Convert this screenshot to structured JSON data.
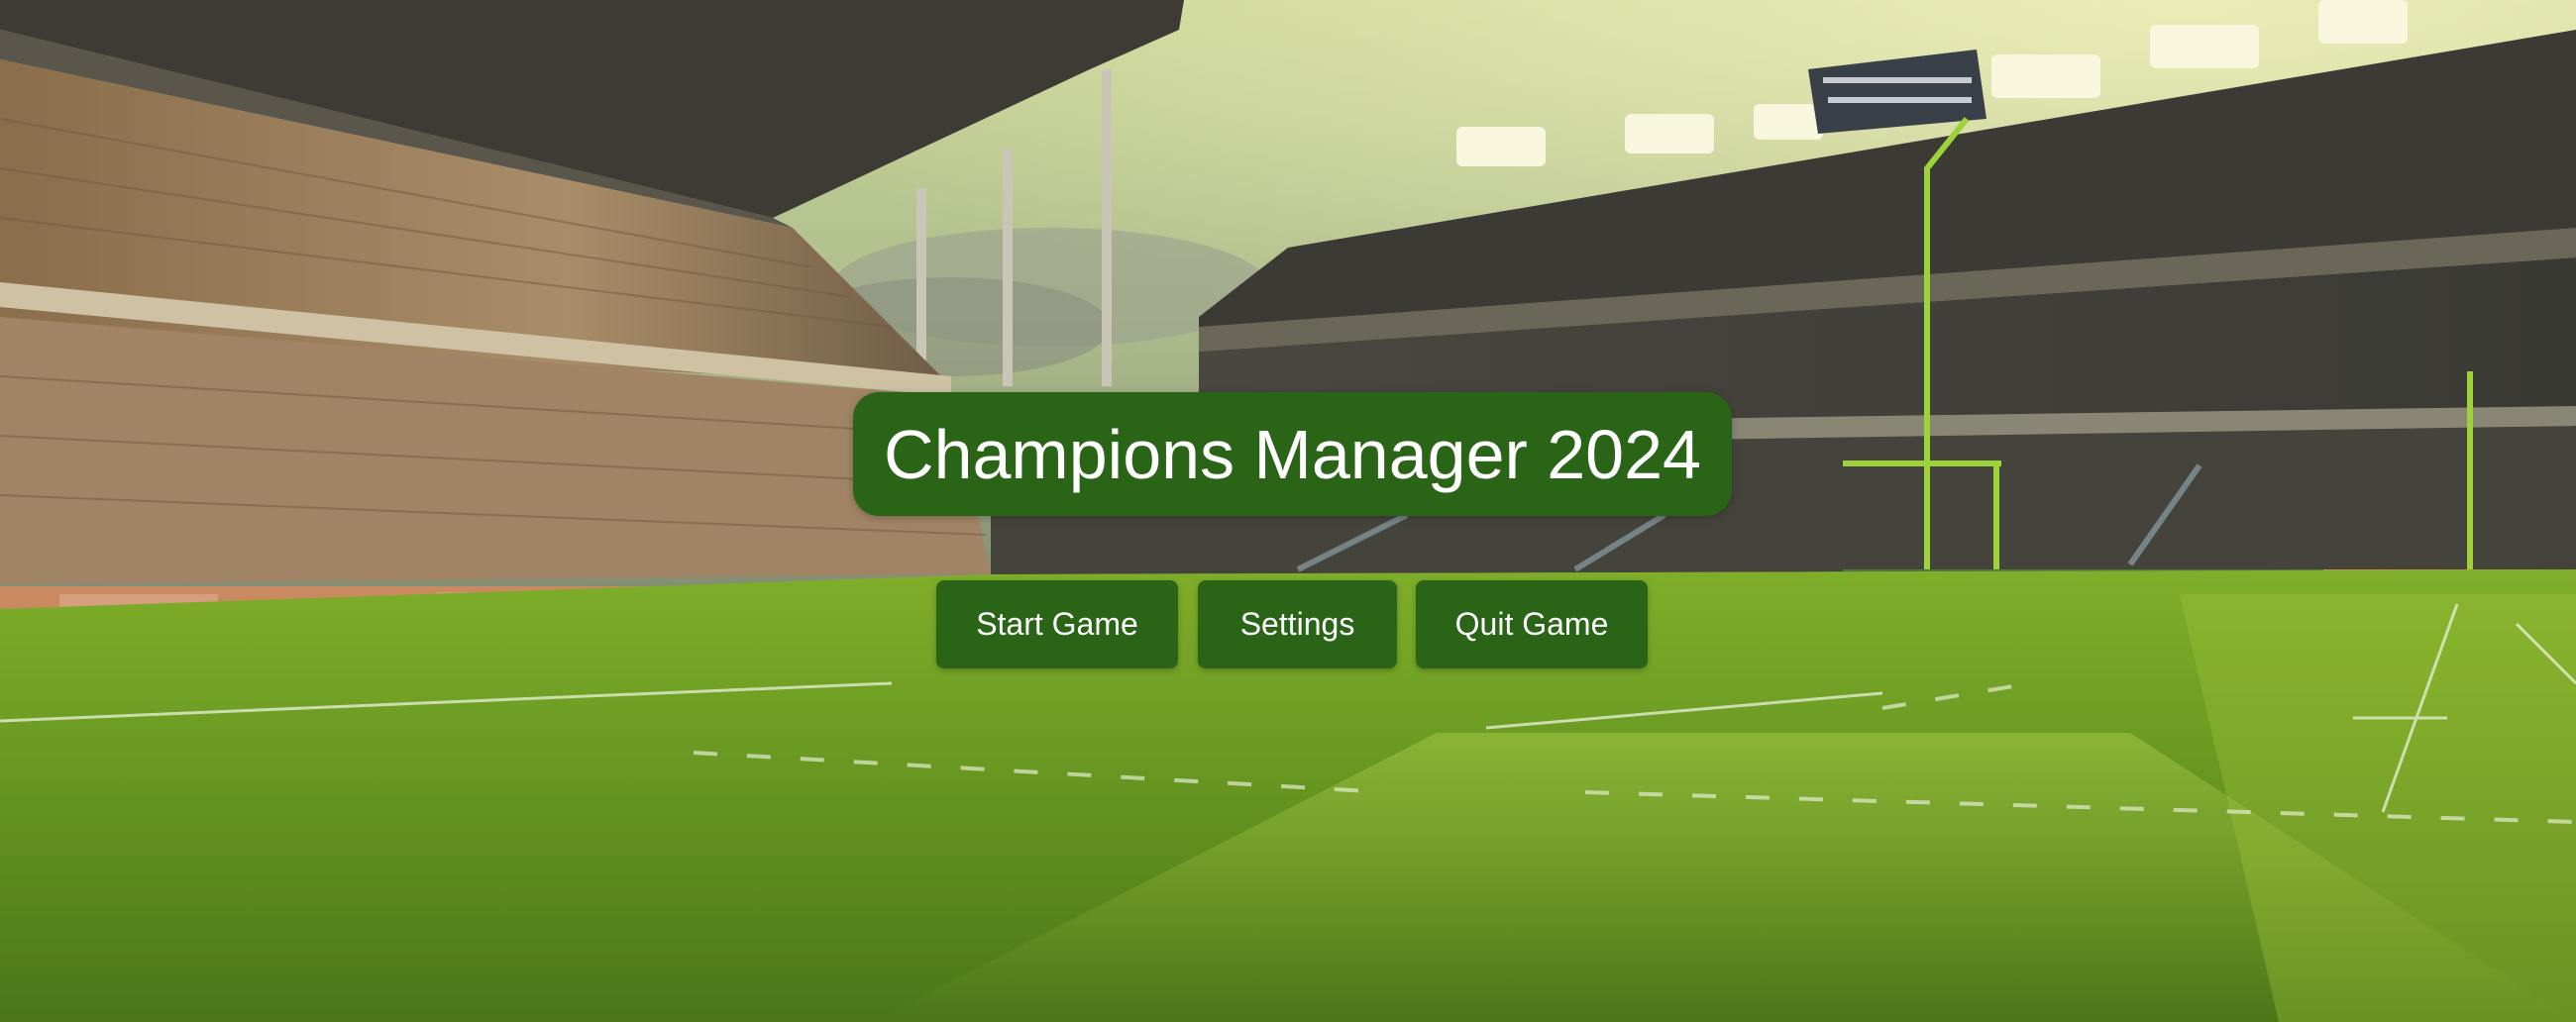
{
  "game": {
    "title": "Champions Manager 2024"
  },
  "menu": {
    "start_label": "Start Game",
    "settings_label": "Settings",
    "quit_label": "Quit Game"
  },
  "colors": {
    "button_bg": "#2a6417",
    "button_text": "#ffffff",
    "title_bg": "#2a6417",
    "field_green": "#6f9a2c"
  },
  "background": {
    "scene": "football-stadium-illustration"
  }
}
